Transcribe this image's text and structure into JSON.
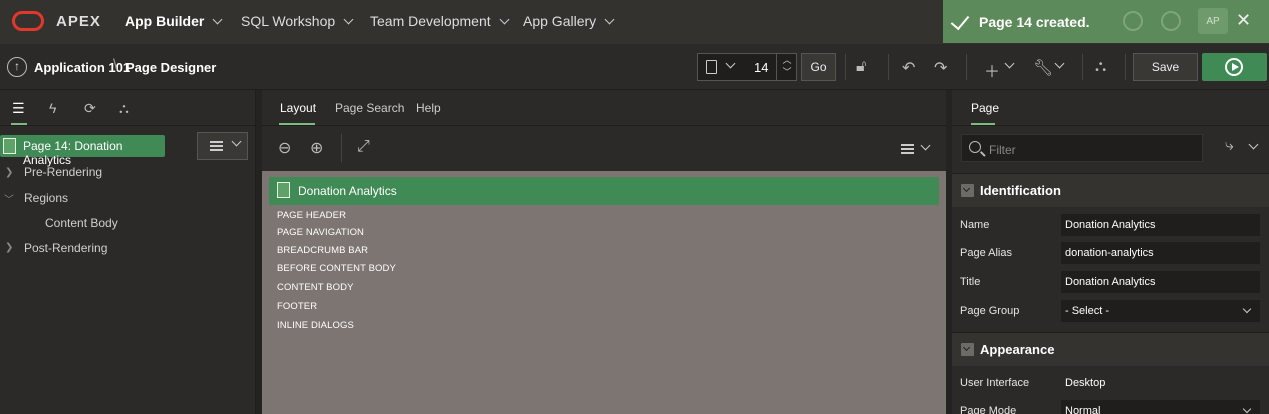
{
  "topbar": {
    "brand": "APEX",
    "nav": [
      {
        "label": "App Builder"
      },
      {
        "label": "SQL Workshop"
      },
      {
        "label": "Team Development"
      },
      {
        "label": "App Gallery"
      }
    ]
  },
  "toast": {
    "message": "Page 14 created.",
    "avatar": "AP"
  },
  "breadcrumb": {
    "app": "Application 101",
    "page": "Page Designer"
  },
  "toolbar": {
    "page_number": "14",
    "go_label": "Go",
    "save_label": "Save"
  },
  "left": {
    "selected": "Page 14: Donation Analytics",
    "tree": [
      {
        "label": "Pre-Rendering"
      },
      {
        "label": "Regions"
      },
      {
        "label": "Content Body"
      },
      {
        "label": "Post-Rendering"
      }
    ]
  },
  "center": {
    "tabs": [
      "Layout",
      "Page Search",
      "Help"
    ],
    "page_title": "Donation Analytics",
    "slots": [
      "PAGE HEADER",
      "PAGE NAVIGATION",
      "BREADCRUMB BAR",
      "BEFORE CONTENT BODY",
      "CONTENT BODY",
      "FOOTER",
      "INLINE DIALOGS"
    ]
  },
  "right": {
    "tab": "Page",
    "filter_placeholder": "Filter",
    "groups": {
      "identification": "Identification",
      "appearance": "Appearance"
    },
    "props": {
      "name_label": "Name",
      "name_value": "Donation Analytics",
      "alias_label": "Page Alias",
      "alias_value": "donation-analytics",
      "title_label": "Title",
      "title_value": "Donation Analytics",
      "group_label": "Page Group",
      "group_value": "- Select -",
      "ui_label": "User Interface",
      "ui_value": "Desktop",
      "mode_label": "Page Mode",
      "mode_value": "Normal"
    }
  },
  "colors": {
    "accent": "#3f8a55",
    "toast": "#5c8a5b",
    "canvas": "#7d7571"
  }
}
